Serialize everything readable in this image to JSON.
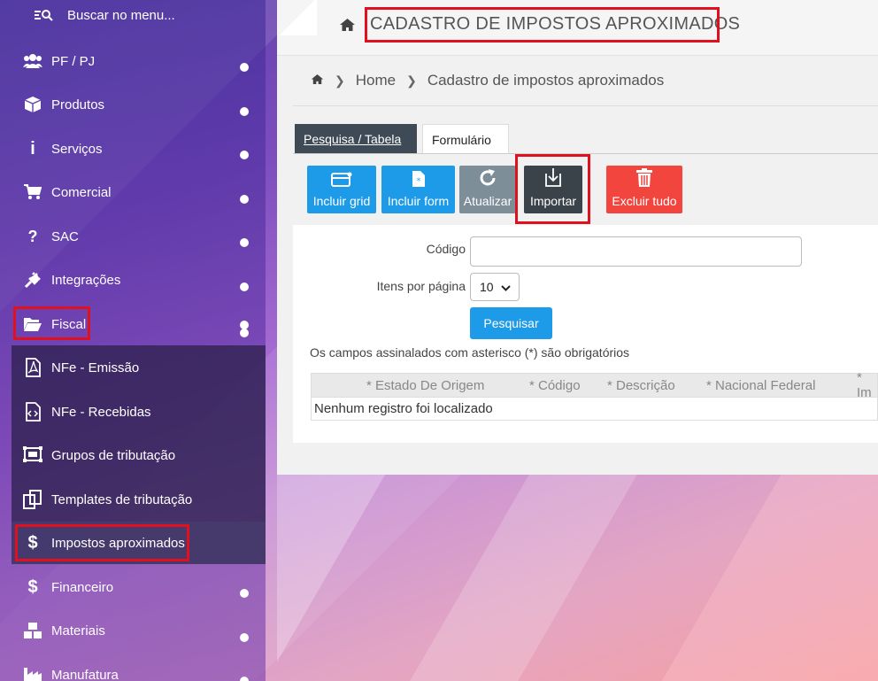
{
  "sidebar": {
    "search_label": "Buscar no menu...",
    "items": [
      {
        "label": "PF / PJ",
        "icon": "users-icon"
      },
      {
        "label": "Produtos",
        "icon": "box-icon"
      },
      {
        "label": "Serviços",
        "icon": "info-icon"
      },
      {
        "label": "Comercial",
        "icon": "cart-icon"
      },
      {
        "label": "SAC",
        "icon": "question-icon"
      },
      {
        "label": "Integrações",
        "icon": "plug-icon"
      },
      {
        "label": "Fiscal",
        "icon": "folder-open-icon"
      }
    ],
    "fiscal_sub": [
      {
        "label": "NFe - Emissão",
        "icon": "pdf-file-icon"
      },
      {
        "label": "NFe - Recebidas",
        "icon": "code-file-icon"
      },
      {
        "label": "Grupos de tributação",
        "icon": "group-icon"
      },
      {
        "label": "Templates de tributação",
        "icon": "templates-icon"
      },
      {
        "label": "Impostos aproximados",
        "icon": "dollar-icon"
      }
    ],
    "items_after": [
      {
        "label": "Financeiro",
        "icon": "dollar-icon"
      },
      {
        "label": "Materiais",
        "icon": "cubes-icon"
      },
      {
        "label": "Manufatura",
        "icon": "factory-icon"
      }
    ]
  },
  "header": {
    "title": "CADASTRO DE IMPOSTOS APROXIMADOS"
  },
  "breadcrumb": {
    "home": "Home",
    "current": "Cadastro de impostos aproximados"
  },
  "tabs": {
    "table": "Pesquisa / Tabela",
    "form": "Formulário"
  },
  "toolbar": {
    "incluir_grid": "Incluir grid",
    "incluir_form": "Incluir form",
    "atualizar": "Atualizar",
    "importar": "Importar",
    "excluir_tudo": "Excluir tudo"
  },
  "form": {
    "codigo_label": "Código",
    "codigo_value": "",
    "itens_label": "Itens por página",
    "itens_value": "10",
    "search_button": "Pesquisar",
    "required_note": "Os campos assinalados com asterisco (*) são obrigatórios"
  },
  "table": {
    "headers": [
      "* Estado De Origem",
      "* Código",
      "* Descrição",
      "* Nacional Federal",
      "* Im"
    ],
    "empty_message": "Nenhum registro foi localizado"
  },
  "colors": {
    "accent_blue": "#1e9be8",
    "danger_red": "#f2453d",
    "highlight_red": "#e0101e",
    "dark_button": "#3a434a"
  }
}
